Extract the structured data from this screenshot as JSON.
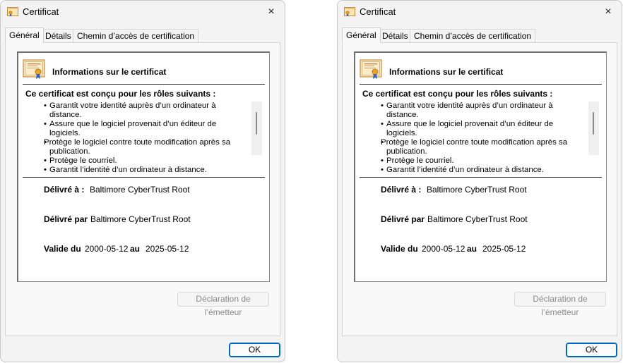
{
  "dialogs": [
    {
      "title": "Certificat",
      "tabs": [
        "Général",
        "Détails",
        "Chemin d’accès de certification"
      ],
      "active_tab": "Général",
      "info_heading": "Informations sur le certificat",
      "roles_heading": "Ce certificat est conçu pour les rôles suivants :",
      "roles": [
        "Garantit votre identité auprès d’un ordinateur à distance.",
        "Assure que le logiciel provenait d’un éditeur de logiciels.",
        "Protège le logiciel contre toute modification après sa publication.",
        "Protège le courriel.",
        "Garantit l’identité d’un ordinateur à distance."
      ],
      "issued_to_label": "Délivré à :",
      "issued_to_value": "Baltimore CyberTrust Root",
      "issued_by_label": "Délivré par",
      "issued_by_value": "Baltimore CyberTrust Root",
      "valid_from_label": "Valide du",
      "valid_from_value": "2000-05-12",
      "valid_to_label": "au",
      "valid_to_value": "2025-05-12",
      "issuer_statement_label": "Déclaration de l’émetteur",
      "ok_label": "OK",
      "close_icon": "×"
    },
    {
      "title": "Certificat",
      "tabs": [
        "Général",
        "Détails",
        "Chemin d’accès de certification"
      ],
      "active_tab": "Général",
      "info_heading": "Informations sur le certificat",
      "roles_heading": "Ce certificat est conçu pour les rôles suivants :",
      "roles": [
        "Garantit votre identité auprès d’un ordinateur à distance.",
        "Assure que le logiciel provenait d’un éditeur de logiciels.",
        "Protège le logiciel contre toute modification après sa publication.",
        "Protège le courriel.",
        "Garantit l’identité d’un ordinateur à distance."
      ],
      "issued_to_label": "Délivré à :",
      "issued_to_value": "Baltimore CyberTrust Root",
      "issued_by_label": "Délivré par",
      "issued_by_value": "Baltimore CyberTrust Root",
      "valid_from_label": "Valide du",
      "valid_from_value": "2000-05-12",
      "valid_to_label": "au",
      "valid_to_value": "2025-05-12",
      "issuer_statement_label": "Déclaration de l’émetteur",
      "ok_label": "OK",
      "close_icon": "×"
    }
  ],
  "icons": {
    "title": "certificate-icon",
    "close": "close-icon",
    "cert": "certificate-icon"
  },
  "colors": {
    "accent": "#0067c0",
    "dialog_bg": "#f3f3f3",
    "disabled_text": "#8a8a8a"
  }
}
